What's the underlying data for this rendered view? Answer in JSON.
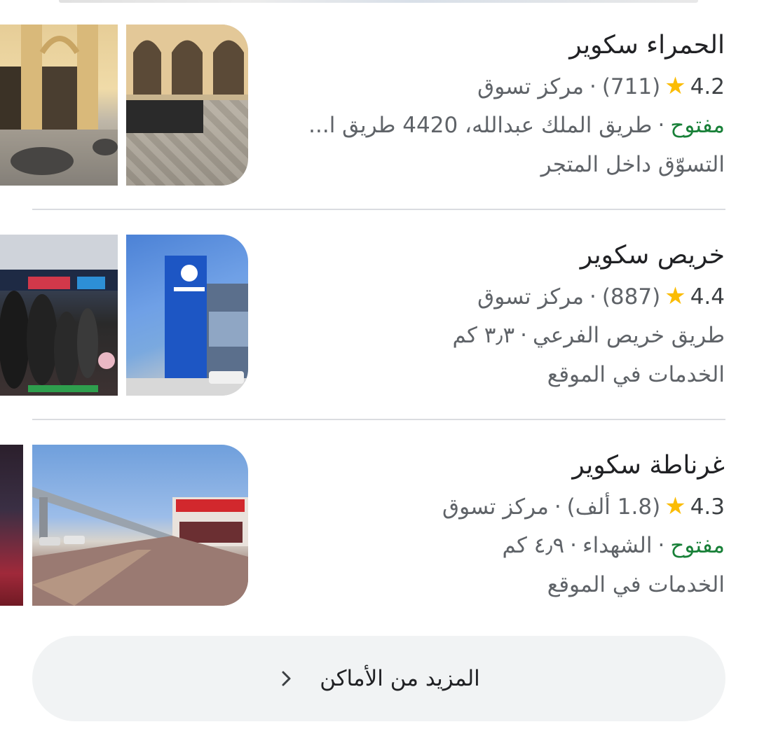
{
  "places": [
    {
      "name": "الحمراء سكوير",
      "rating": "4.2",
      "reviews": "(711)",
      "category": "مركز تسوق",
      "status": "مفتوح",
      "address": "طريق الملك عبدالله، 4420 طريق ا...",
      "service": "التسوّق داخل المتجر",
      "image_main": "mall interior courtyard with cafe seating",
      "image_side": "arched arcade with cafe chairs"
    },
    {
      "name": "خريص سكوير",
      "rating": "4.4",
      "reviews": "(887)",
      "category": "مركز تسوق",
      "address": "طريق خريص الفرعي",
      "distance": "٣٫٣ كم",
      "service": "الخدمات في الموقع",
      "image_main": "building exterior with AL SADHAN sign under blue sky",
      "image_side": "crowded supermarket interior"
    },
    {
      "name": "غرناطة سكوير",
      "rating": "4.3",
      "reviews": "(1.8 ألف)",
      "category": "مركز تسوق",
      "status": "مفتوح",
      "address": "الشهداء",
      "distance": "٤٫٩ كم",
      "service": "الخدمات في الموقع",
      "image_main": "paved plaza with storefront and overpass",
      "image_side": "illuminated storefront at night"
    }
  ],
  "more_places_label": "المزيد من الأماكن",
  "icons": {
    "star": "star-icon",
    "chevron": "chevron-right-icon"
  },
  "colors": {
    "star": "#fbbc04",
    "open": "#188038",
    "secondary_text": "#5f6368",
    "button_bg": "#f1f3f4",
    "divider": "#dadce0"
  }
}
